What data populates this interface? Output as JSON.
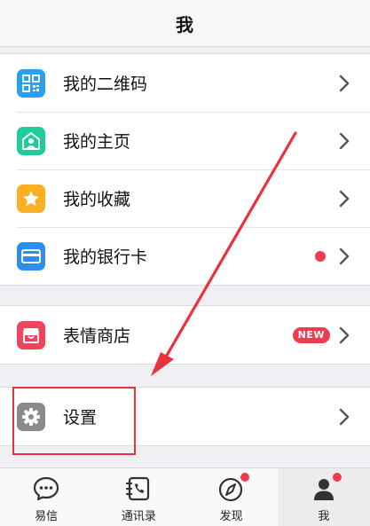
{
  "header": {
    "title": "我"
  },
  "menu_group_1": [
    {
      "label": "我的二维码",
      "icon": "qr-code-icon",
      "color": "#2aa0f0"
    },
    {
      "label": "我的主页",
      "icon": "home-icon",
      "color": "#1fcd9a"
    },
    {
      "label": "我的收藏",
      "icon": "star-icon",
      "color": "#fcae25"
    },
    {
      "label": "我的银行卡",
      "icon": "bank-card-icon",
      "color": "#2c8ff0",
      "has_dot": true
    }
  ],
  "menu_group_2": [
    {
      "label": "表情商店",
      "icon": "sticker-store-icon",
      "color": "#f0445a",
      "badge": "NEW"
    }
  ],
  "menu_group_3": [
    {
      "label": "设置",
      "icon": "gear-icon",
      "color": "#8a8a8a"
    }
  ],
  "tabbar": {
    "tabs": [
      {
        "label": "易信",
        "icon": "chat-bubble-icon"
      },
      {
        "label": "通讯录",
        "icon": "contacts-icon"
      },
      {
        "label": "发现",
        "icon": "compass-icon",
        "has_dot": true
      },
      {
        "label": "我",
        "icon": "person-icon",
        "has_dot": true,
        "active": true
      }
    ]
  },
  "colors": {
    "accent_red": "#ef3b50",
    "annotation_red": "#e8323c",
    "background": "#efeff4"
  }
}
